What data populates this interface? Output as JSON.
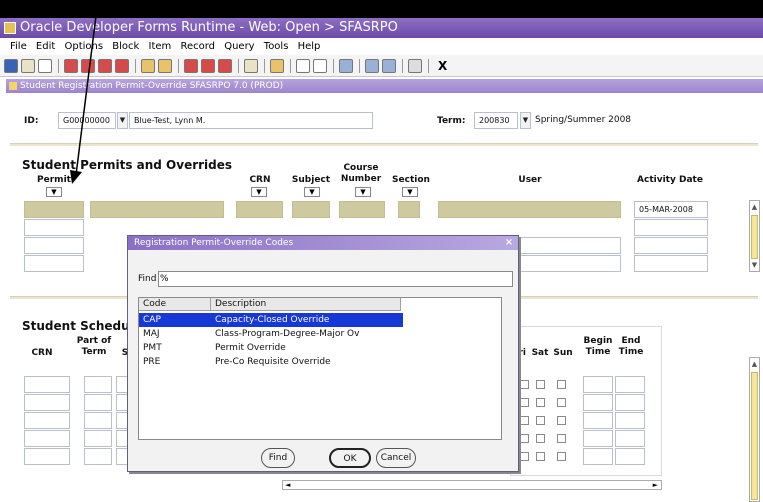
{
  "window": {
    "title": "Oracle Developer Forms Runtime - Web:  Open > SFASRPO"
  },
  "menu": [
    "File",
    "Edit",
    "Options",
    "Block",
    "Item",
    "Record",
    "Query",
    "Tools",
    "Help"
  ],
  "toolbar": {
    "exit_label": "X"
  },
  "form": {
    "title": "Student Registration Permit-Override  SFASRPO  7.0  (PROD)"
  },
  "key_block": {
    "id_label": "ID:",
    "id_value": "G00000000",
    "name_value": "Blue-Test, Lynn M.",
    "term_label": "Term:",
    "term_code": "200830",
    "term_desc": "Spring/Summer 2008",
    "lov_glyph": "▼"
  },
  "permits": {
    "title": "Student Permits and Overrides",
    "columns": {
      "permit": "Permit",
      "crn": "CRN",
      "subject": "Subject",
      "course_number": "Course\nNumber",
      "section": "Section",
      "user": "User",
      "activity_date": "Activity Date"
    },
    "sort_glyph": "▼",
    "first_row": {
      "activity_date": "05-MAR-2008"
    }
  },
  "schedule": {
    "title": "Student Schedule",
    "columns": {
      "crn": "CRN",
      "part_of_term": "Part of\nTerm",
      "s": "S",
      "fri": "Fri",
      "sat": "Sat",
      "sun": "Sun",
      "begin_time": "Begin\nTime",
      "end_time": "End\nTime"
    }
  },
  "dialog": {
    "title": "Registration Permit-Override Codes",
    "close_glyph": "×",
    "find_label": "Find",
    "find_value": "%",
    "headers": {
      "code": "Code",
      "description": "Description"
    },
    "rows": [
      {
        "code": "CAP",
        "description": "Capacity-Closed Override"
      },
      {
        "code": "MAJ",
        "description": "Class-Program-Degree-Major Ov"
      },
      {
        "code": "PMT",
        "description": "Permit Override"
      },
      {
        "code": "PRE",
        "description": "Pre-Co Requisite Override"
      }
    ],
    "buttons": {
      "find": "Find",
      "ok": "OK",
      "cancel": "Cancel"
    }
  },
  "colors": {
    "accent": "#6b4aa8",
    "selection": "#1638d6",
    "current_record": "#cfc9a0"
  }
}
